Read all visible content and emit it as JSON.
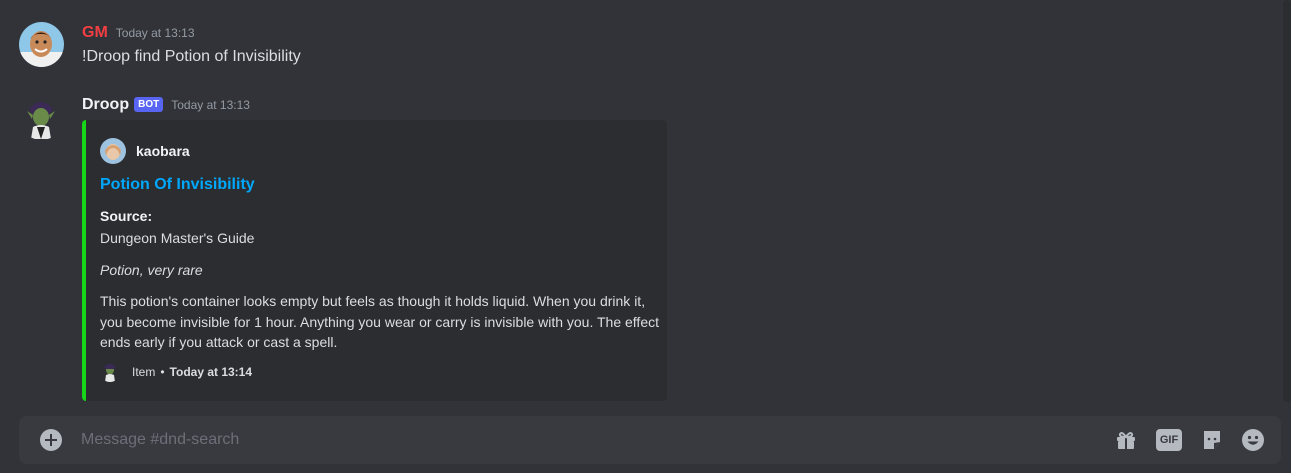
{
  "messages": [
    {
      "username": "GM",
      "username_color": "#f23f43",
      "timestamp": "Today at 13:13",
      "content": "!Droop find Potion of Invisibility"
    },
    {
      "username": "Droop",
      "username_color": "#f2f3f5",
      "bot_tag": "BOT",
      "timestamp": "Today at 13:13",
      "embed": {
        "accent_color": "#17d617",
        "author": "kaobara",
        "title": "Potion Of Invisibility",
        "field_name": "Source:",
        "field_value": "Dungeon Master's Guide",
        "subtitle": "Potion, very rare",
        "description": "This potion's container looks empty but feels as though it holds liquid. When you drink it, you become invisible for 1 hour. Anything you wear or carry is invisible with you. The effect ends early if you attack or cast a spell.",
        "footer_text": "Item",
        "footer_separator": "•",
        "footer_time": "Today at 13:14"
      }
    }
  ],
  "composer": {
    "placeholder": "Message #dnd-search",
    "icons": [
      "add-icon",
      "gift-icon",
      "gif-icon",
      "sticker-icon",
      "emoji-icon"
    ],
    "gif_label": "GIF"
  }
}
